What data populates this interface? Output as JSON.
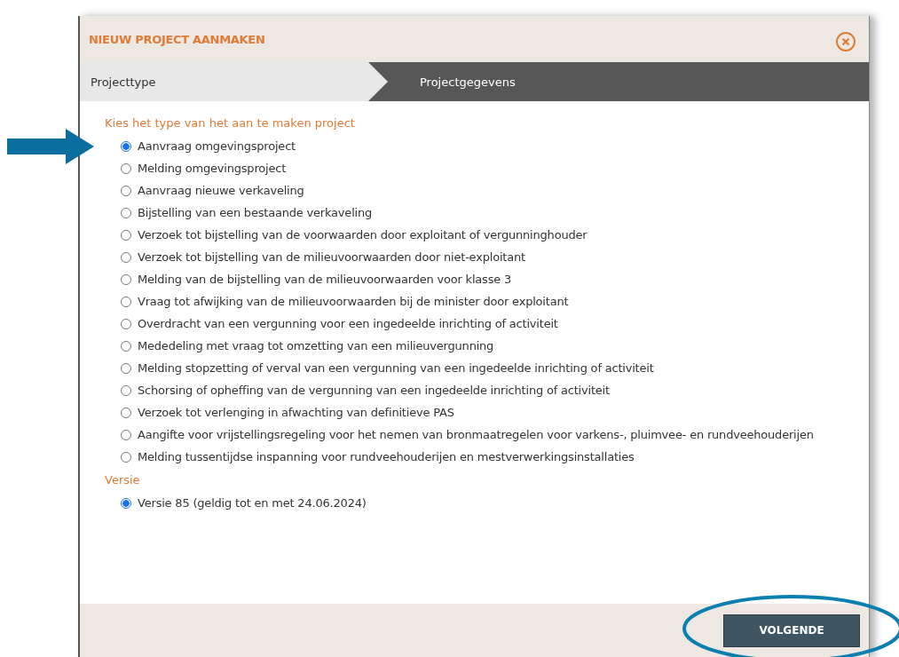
{
  "dialog": {
    "title": "NIEUW PROJECT AANMAKEN"
  },
  "steps": [
    {
      "label": "Projecttype",
      "selected": true
    },
    {
      "label": "Projectgegevens",
      "selected": false
    }
  ],
  "project_type": {
    "heading": "Kies het type van het aan te maken project",
    "options": [
      {
        "label": "Aanvraag omgevingsproject",
        "selected": true
      },
      {
        "label": "Melding omgevingsproject",
        "selected": false
      },
      {
        "label": "Aanvraag nieuwe verkaveling",
        "selected": false
      },
      {
        "label": "Bijstelling van een bestaande verkaveling",
        "selected": false
      },
      {
        "label": "Verzoek tot bijstelling van de voorwaarden door exploitant of vergunninghouder",
        "selected": false
      },
      {
        "label": "Verzoek tot bijstelling van de milieuvoorwaarden door niet-exploitant",
        "selected": false
      },
      {
        "label": "Melding van de bijstelling van de milieuvoorwaarden voor klasse 3",
        "selected": false
      },
      {
        "label": "Vraag tot afwijking van de milieuvoorwaarden bij de minister door exploitant",
        "selected": false
      },
      {
        "label": "Overdracht van een vergunning voor een ingedeelde inrichting of activiteit",
        "selected": false
      },
      {
        "label": "Mededeling met vraag tot omzetting van een milieuvergunning",
        "selected": false
      },
      {
        "label": "Melding stopzetting of verval van een vergunning van een ingedeelde inrichting of activiteit",
        "selected": false
      },
      {
        "label": "Schorsing of opheffing van de vergunning van een ingedeelde inrichting of activiteit",
        "selected": false
      },
      {
        "label": "Verzoek tot verlenging in afwachting van definitieve PAS",
        "selected": false
      },
      {
        "label": "Aangifte voor vrijstellingsregeling voor het nemen van bronmaatregelen voor varkens-, pluimvee- en rundveehouderijen",
        "selected": false
      },
      {
        "label": "Melding tussentijdse inspanning voor rundveehouderijen en mestverwerkingsinstallaties",
        "selected": false
      }
    ]
  },
  "version": {
    "heading": "Versie",
    "options": [
      {
        "label": "Versie 85 (geldig tot en met 24.06.2024)",
        "selected": true
      }
    ]
  },
  "buttons": [
    "VOLGENDE"
  ]
}
